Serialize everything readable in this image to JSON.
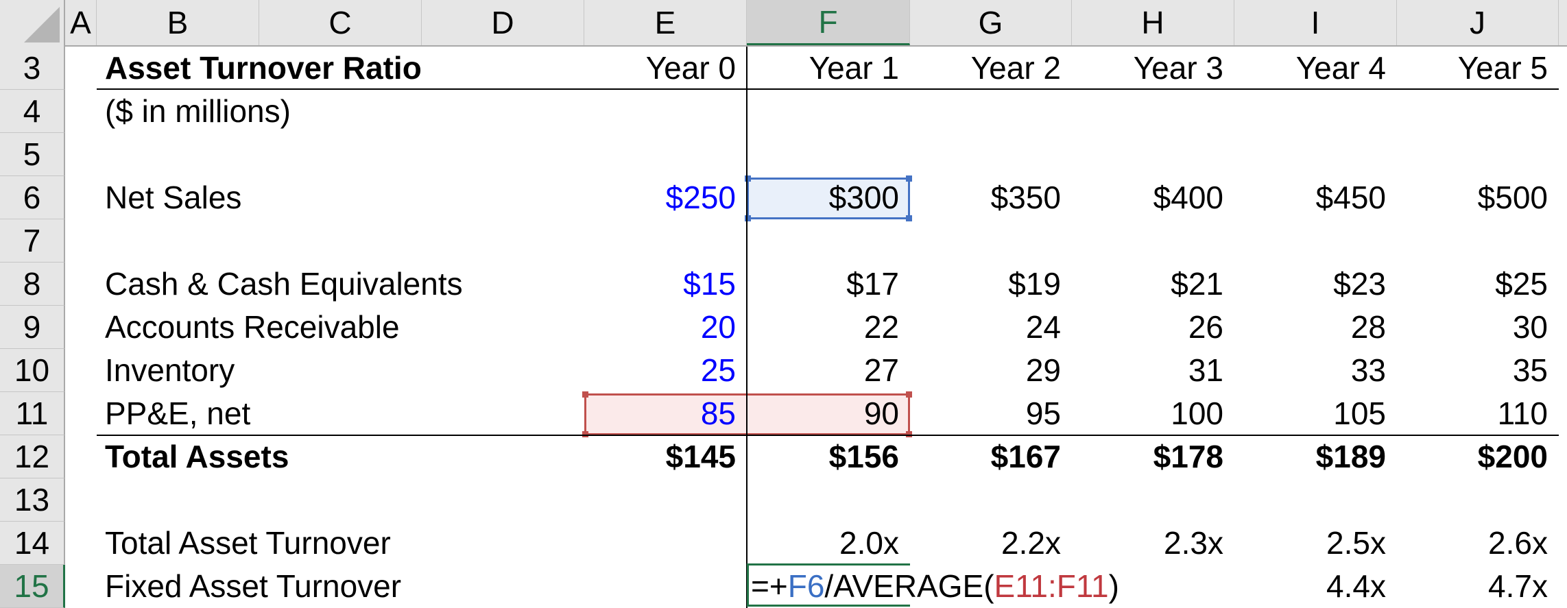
{
  "columns": [
    "A",
    "B",
    "C",
    "D",
    "E",
    "F",
    "G",
    "H",
    "I",
    "J"
  ],
  "selected_column": "F",
  "rows": [
    "3",
    "4",
    "5",
    "6",
    "7",
    "8",
    "9",
    "10",
    "11",
    "12",
    "13",
    "14",
    "15"
  ],
  "selected_row": "15",
  "title": "Asset Turnover Ratio",
  "subtitle": "($ in millions)",
  "years": [
    "Year 0",
    "Year 1",
    "Year 2",
    "Year 3",
    "Year 4",
    "Year 5"
  ],
  "line_items": [
    {
      "label": "Net Sales",
      "row": "6",
      "values": [
        "$250",
        "$300",
        "$350",
        "$400",
        "$450",
        "$500"
      ],
      "bold": false
    },
    {
      "label": "Cash & Cash Equivalents",
      "row": "8",
      "values": [
        "$15",
        "$17",
        "$19",
        "$21",
        "$23",
        "$25"
      ],
      "bold": false
    },
    {
      "label": "Accounts Receivable",
      "row": "9",
      "values": [
        "20",
        "22",
        "24",
        "26",
        "28",
        "30"
      ],
      "bold": false
    },
    {
      "label": "Inventory",
      "row": "10",
      "values": [
        "25",
        "27",
        "29",
        "31",
        "33",
        "35"
      ],
      "bold": false
    },
    {
      "label": "PP&E, net",
      "row": "11",
      "values": [
        "85",
        "90",
        "95",
        "100",
        "105",
        "110"
      ],
      "bold": false
    },
    {
      "label": "Total Assets",
      "row": "12",
      "values": [
        "$145",
        "$156",
        "$167",
        "$178",
        "$189",
        "$200"
      ],
      "bold": true
    },
    {
      "label": "Total Asset Turnover",
      "row": "14",
      "values": [
        "",
        "2.0x",
        "2.2x",
        "2.3x",
        "2.5x",
        "2.6x"
      ],
      "bold": false
    },
    {
      "label": "Fixed Asset Turnover",
      "row": "15",
      "values": [
        "",
        "",
        "",
        "",
        "4.4x",
        "4.7x"
      ],
      "bold": false
    }
  ],
  "formula": {
    "cell": "F15",
    "parts": [
      {
        "text": "=+",
        "color": "default"
      },
      {
        "text": "F6",
        "color": "blue"
      },
      {
        "text": "/AVERAGE(",
        "color": "default"
      },
      {
        "text": "E11:F11",
        "color": "red"
      },
      {
        "text": ")",
        "color": "default"
      }
    ]
  },
  "colors": {
    "input_blue": "#0000ff",
    "ref_blue": "#4472c4",
    "ref_red": "#c0504d",
    "excel_green": "#217346"
  }
}
